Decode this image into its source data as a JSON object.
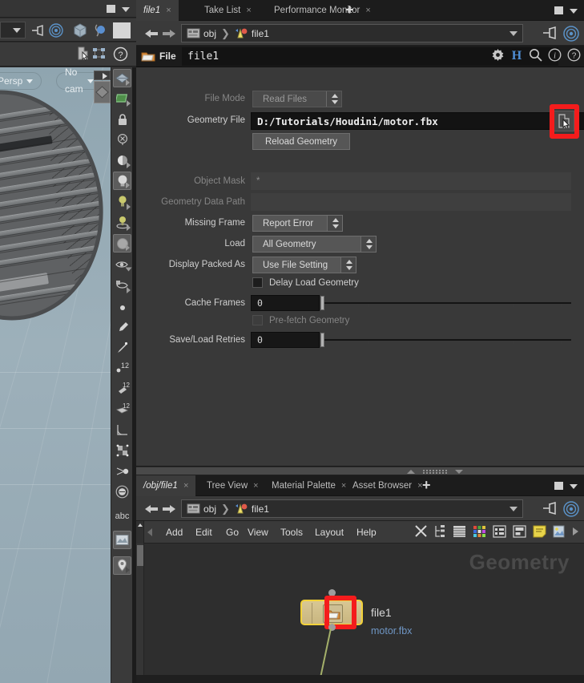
{
  "viewport": {
    "camera_mode": "Persp",
    "camera": "No cam",
    "icons": [
      "pin-icon",
      "target-icon",
      "cube-icon",
      "light-sphere-icon",
      "material-swatch-icon",
      "select-cursor-icon",
      "node-tree-icon",
      "help-icon"
    ],
    "toolbar_icons": [
      "view-display-icon",
      "flat-shading-icon",
      "lock-icon",
      "x-sphere-icon",
      "half-sphere-icon",
      "light-bulb-icon",
      "point-light-icon",
      "spot-light-icon",
      "environment-sphere-icon",
      "eye-hide-icon",
      "eye-paint-icon",
      "point-icon",
      "brush-icon",
      "needle-icon",
      "points-12-icon",
      "brush-12-icon",
      "faces-12-icon",
      "angle-icon",
      "checker-icon",
      "joint-icon",
      "circle-icon",
      "abc-text-icon",
      "image-plane-icon",
      "marker-pin-icon"
    ]
  },
  "top_pane": {
    "tabs": [
      {
        "label": "file1",
        "active": true,
        "closable": true
      },
      {
        "label": "Take List",
        "active": false,
        "closable": true
      },
      {
        "label": "Performance Monitor",
        "active": false,
        "closable": true
      }
    ],
    "add_tab": "+",
    "path": {
      "root": "obj",
      "node": "file1",
      "root_icon": "obj-network-icon",
      "node_icon": "sop-geometry-icon"
    },
    "right_icons": [
      "pin-icon",
      "target-icon"
    ]
  },
  "parameter_panel": {
    "node_type_label": "File",
    "node_name": "file1",
    "node_icon": "file-sop-icon",
    "header_icons": [
      "gear-icon",
      "houdini-h-icon",
      "search-icon",
      "info-icon",
      "help-icon"
    ],
    "rows": [
      {
        "label": "File Mode",
        "type": "menu",
        "value": "Read Files",
        "disabled": true
      },
      {
        "label": "Geometry File",
        "type": "file",
        "value": "D:/Tutorials/Houdini/motor.fbx",
        "disabled": false
      },
      {
        "label": "",
        "type": "button",
        "value": "Reload Geometry",
        "disabled": false
      },
      {
        "label": "Object Mask",
        "type": "flat",
        "value": "*",
        "disabled": true
      },
      {
        "label": "Geometry Data Path",
        "type": "flat",
        "value": "",
        "disabled": true
      },
      {
        "label": "Missing Frame",
        "type": "menu",
        "value": "Report Error",
        "disabled": false
      },
      {
        "label": "Load",
        "type": "menu",
        "value": "All Geometry",
        "disabled": false
      },
      {
        "label": "Display Packed As",
        "type": "menu",
        "value": "Use File Setting",
        "disabled": false
      },
      {
        "label": "",
        "type": "checkbox",
        "value": "Delay Load Geometry",
        "checked": false,
        "disabled": false
      },
      {
        "label": "Cache Frames",
        "type": "slider",
        "value": "0",
        "disabled": false
      },
      {
        "label": "",
        "type": "checkbox",
        "value": "Pre-fetch Geometry",
        "checked": false,
        "disabled": true
      },
      {
        "label": "Save/Load Retries",
        "type": "slider",
        "value": "0",
        "disabled": false
      }
    ],
    "browse_button_icon": "file-browser-cursor-icon",
    "highlight_color": "#f41c1c"
  },
  "network_pane": {
    "tabs": [
      {
        "label": "/obj/file1",
        "active": true,
        "closable": true
      },
      {
        "label": "Tree View",
        "active": false,
        "closable": true
      },
      {
        "label": "Material Palette",
        "active": false,
        "closable": true
      },
      {
        "label": "Asset Browser",
        "active": false,
        "closable": true
      }
    ],
    "add_tab": "+",
    "path": {
      "root": "obj",
      "node": "file1"
    },
    "menu_items": [
      "Add",
      "Edit",
      "Go",
      "View",
      "Tools",
      "Layout",
      "Help"
    ],
    "toolbar_icons": [
      "tools-wrench-icon",
      "hierarchy-icon",
      "list-view-icon",
      "color-palette-icon",
      "grid-view-icon",
      "snapshot-icon",
      "sticky-note-icon",
      "image-node-icon",
      "play-arrow-icon"
    ],
    "watermark": "Geometry",
    "node": {
      "name": "file1",
      "subtitle": "motor.fbx",
      "icon": "file-sop-icon",
      "selected": true,
      "highlighted": true
    }
  },
  "colors": {
    "accent_yellow": "#f2d23a",
    "highlight_red": "#f41c1c",
    "node_body": "#d8c794",
    "link_blue": "#6f96c4",
    "wire_green": "#a4b06a"
  }
}
